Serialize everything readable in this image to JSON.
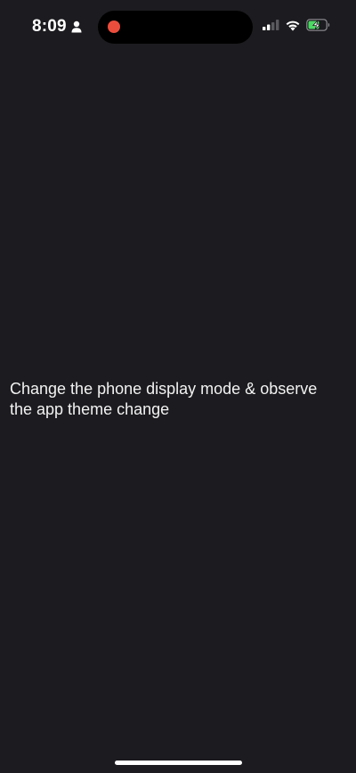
{
  "status_bar": {
    "time": "8:09",
    "person_icon": "person-icon",
    "recording_indicator_color": "#eb4d3d",
    "signal_icon": "cellular-signal-icon",
    "wifi_icon": "wifi-icon",
    "battery_icon": "battery-charging-icon",
    "battery_color": "#4cd964"
  },
  "main": {
    "message": "Change the phone display mode & observe the app theme change"
  },
  "colors": {
    "background": "#1c1b1f",
    "text": "#f2f2f2"
  }
}
